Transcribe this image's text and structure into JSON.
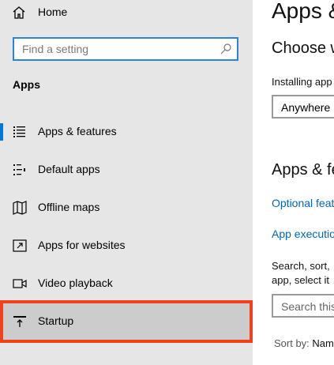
{
  "sidebar": {
    "home_label": "Home",
    "search_placeholder": "Find a setting",
    "section_title": "Apps",
    "items": [
      {
        "label": "Apps & features",
        "icon": "apps-features-icon"
      },
      {
        "label": "Default apps",
        "icon": "default-apps-icon"
      },
      {
        "label": "Offline maps",
        "icon": "offline-maps-icon"
      },
      {
        "label": "Apps for websites",
        "icon": "apps-for-websites-icon"
      },
      {
        "label": "Video playback",
        "icon": "video-playback-icon"
      },
      {
        "label": "Startup",
        "icon": "startup-icon"
      }
    ]
  },
  "main": {
    "title": "Apps &",
    "choose_heading": "Choose w",
    "installing_text": "Installing app",
    "dropdown_value": "Anywhere",
    "apps_features_heading": "Apps & fe",
    "link_optional": "Optional feat",
    "link_execution": "App executio",
    "search_text_line1": "Search, sort,",
    "search_text_line2": "app, select it",
    "search_placeholder": "Search this",
    "sort_label": "Sort by:",
    "sort_value": "Nam"
  },
  "colors": {
    "accent": "#0078d7",
    "highlight": "#f0401c",
    "link": "#0067b8",
    "sidebar_bg": "#e6e6e6"
  }
}
